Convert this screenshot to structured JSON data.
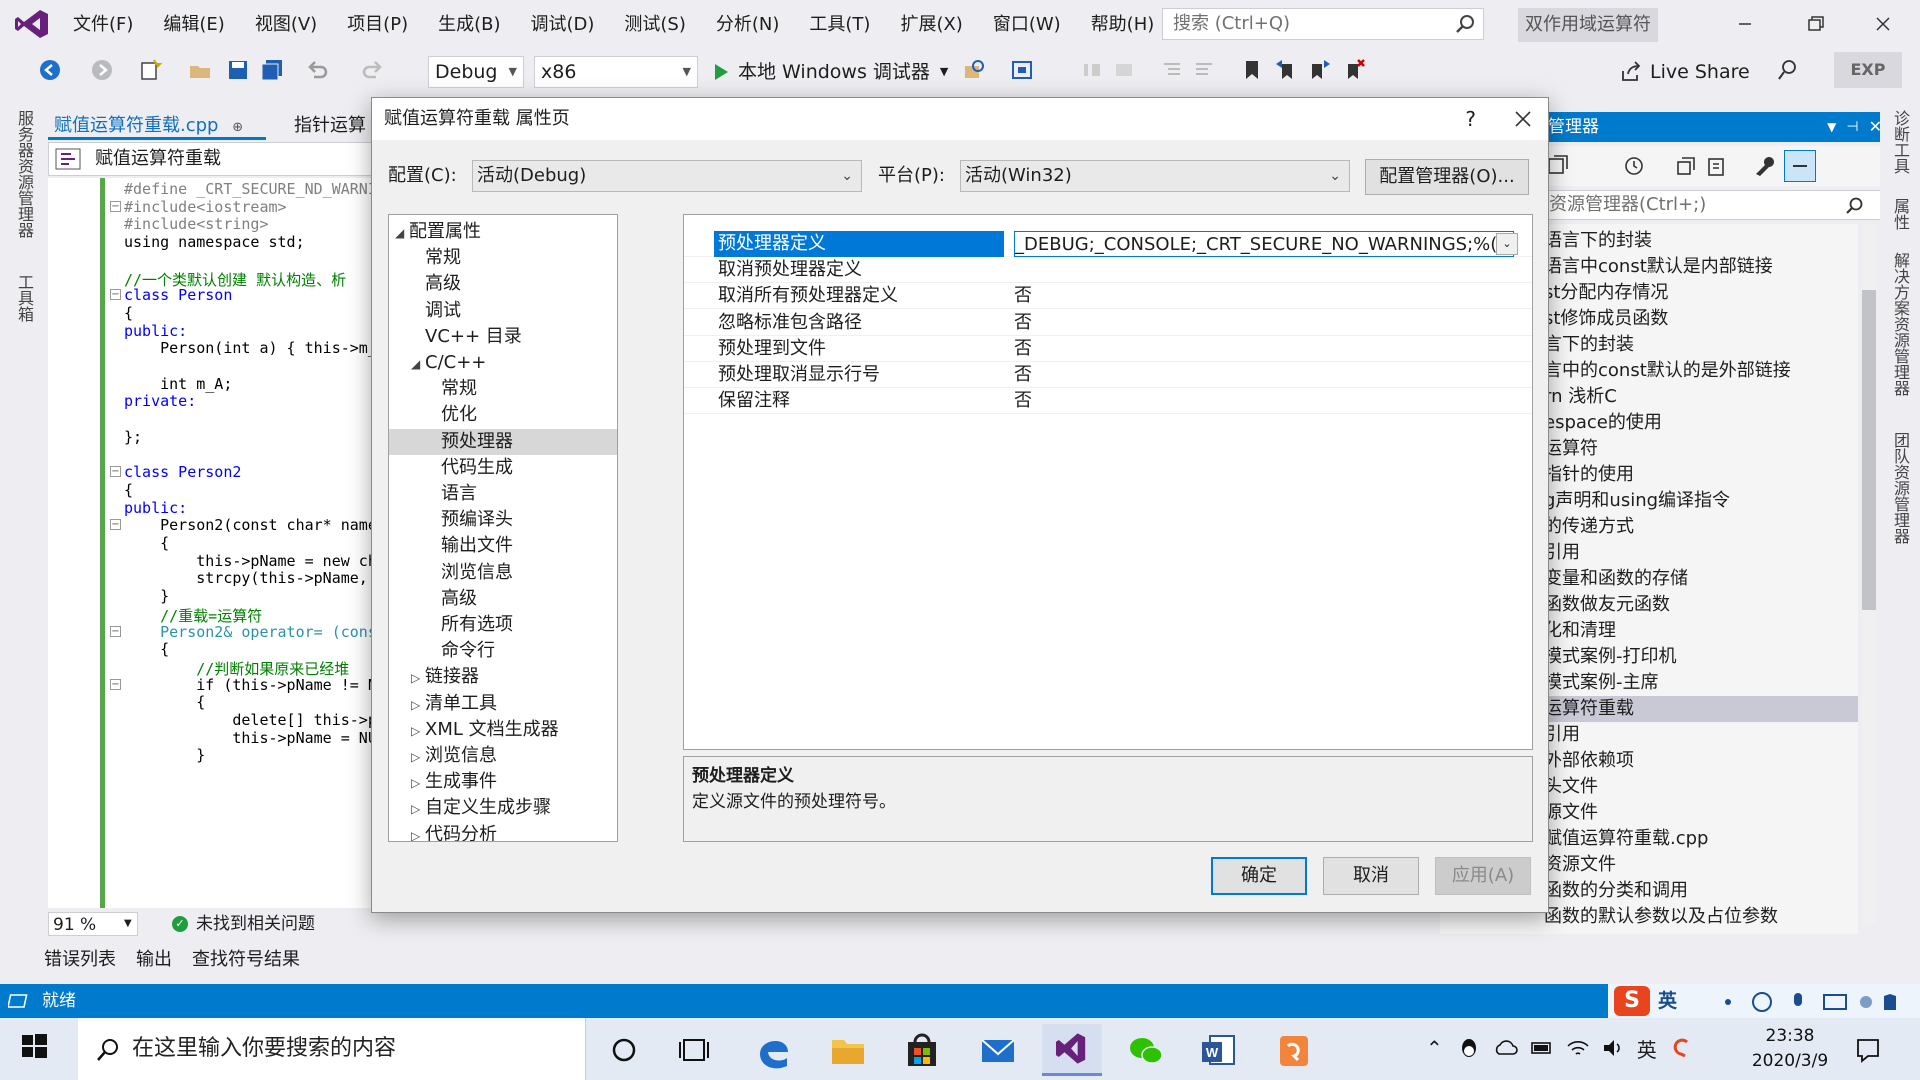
{
  "menu": [
    "文件(F)",
    "编辑(E)",
    "视图(V)",
    "项目(P)",
    "生成(B)",
    "调试(D)",
    "测试(S)",
    "分析(N)",
    "工具(T)",
    "扩展(X)",
    "窗口(W)",
    "帮助(H)"
  ],
  "search_placeholder": "搜索 (Ctrl+Q)",
  "project_title": "双作用域运算符",
  "toolbar": {
    "config": "Debug",
    "platform": "x86",
    "debug_start": "本地 Windows 调试器",
    "live_share": "Live Share",
    "exp": "EXP"
  },
  "left_rail": [
    "服务器资源管理器",
    "工具箱"
  ],
  "right_rail": [
    "诊断工具",
    "属性",
    "解决方案资源管理器",
    "团队资源管理器"
  ],
  "editor": {
    "tabs": [
      "赋值运算符重载.cpp",
      "指针运算符"
    ],
    "tab_pin": "⊕ ✕",
    "nav": "赋值运算符重载",
    "zoom": "91 %",
    "issues": "未找到相关问题"
  },
  "code_lines": [
    {
      "t": "#define _CRT_SECURE_ND_WARNI",
      "c": "pp"
    },
    {
      "t": "#include<iostream>",
      "c": "pp"
    },
    {
      "t": "#include<string>",
      "c": "pp"
    },
    {
      "t": "using namespace std;",
      "c": ""
    },
    {
      "t": "",
      "c": ""
    },
    {
      "t": "//一个类默认创建 默认构造、析",
      "c": "cm"
    },
    {
      "t": "class Person",
      "c": "kw"
    },
    {
      "t": "{",
      "c": ""
    },
    {
      "t": "public:",
      "c": "kw"
    },
    {
      "t": "    Person(int a) { this->m_",
      "c": ""
    },
    {
      "t": "",
      "c": ""
    },
    {
      "t": "    int m_A;",
      "c": ""
    },
    {
      "t": "private:",
      "c": "kw"
    },
    {
      "t": "",
      "c": ""
    },
    {
      "t": "};",
      "c": ""
    },
    {
      "t": "",
      "c": ""
    },
    {
      "t": "class Person2",
      "c": "kw"
    },
    {
      "t": "{",
      "c": ""
    },
    {
      "t": "public:",
      "c": "kw"
    },
    {
      "t": "    Person2(const char* name",
      "c": ""
    },
    {
      "t": "    {",
      "c": ""
    },
    {
      "t": "        this->pName = new ch",
      "c": ""
    },
    {
      "t": "        strcpy(this->pName,",
      "c": ""
    },
    {
      "t": "    }",
      "c": ""
    },
    {
      "t": "    //重载=运算符",
      "c": "cm"
    },
    {
      "t": "    Person2& operator= (cons",
      "c": "ty"
    },
    {
      "t": "    {",
      "c": ""
    },
    {
      "t": "        //判断如果原来已经堆",
      "c": "cm"
    },
    {
      "t": "        if (this->pName != N",
      "c": ""
    },
    {
      "t": "        {",
      "c": ""
    },
    {
      "t": "            delete[] this->p",
      "c": ""
    },
    {
      "t": "            this->pName = NU",
      "c": ""
    },
    {
      "t": "        }",
      "c": ""
    }
  ],
  "bottom_tabs": [
    "错误列表",
    "输出",
    "查找符号结果"
  ],
  "solution": {
    "header": "管理器",
    "search": "资源管理器(Ctrl+;)",
    "items": [
      "语言下的封装",
      "语言中const默认是内部链接",
      "st分配内存情况",
      "st修饰成员函数",
      "言下的封装",
      "言中的const默认的是外部链接",
      "rn 浅析C",
      "espace的使用",
      "运算符",
      "指针的使用",
      "g声明和using编译指令",
      "的传递方式",
      "引用",
      "变量和函数的存储",
      "函数做友元函数",
      "化和清理",
      "模式案例-打印机",
      "模式案例-主席",
      "运算符重载",
      "引用",
      "外部依赖项",
      "头文件",
      "源文件",
      "赋值运算符重载.cpp",
      "资源文件",
      "函数的分类和调用",
      "函数的默认参数以及占位参数"
    ],
    "selected_index": 18
  },
  "status": "就绪",
  "ime": {
    "lang": "英"
  },
  "taskbar": {
    "search": "在这里输入你要搜索的内容",
    "time": "23:38",
    "date": "2020/3/9",
    "tray_lang": "英"
  },
  "dialog": {
    "title": "赋值运算符重载 属性页",
    "help": "?",
    "config_label": "配置(C):",
    "config_value": "活动(Debug)",
    "platform_label": "平台(P):",
    "platform_value": "活动(Win32)",
    "config_manager": "配置管理器(O)...",
    "tree": [
      {
        "label": "配置属性",
        "level": 0,
        "arrow": "◢"
      },
      {
        "label": "常规",
        "level": 1,
        "arrow": ""
      },
      {
        "label": "高级",
        "level": 1,
        "arrow": ""
      },
      {
        "label": "调试",
        "level": 1,
        "arrow": ""
      },
      {
        "label": "VC++ 目录",
        "level": 1,
        "arrow": ""
      },
      {
        "label": "C/C++",
        "level": 1,
        "arrow": "◢"
      },
      {
        "label": "常规",
        "level": 2,
        "arrow": ""
      },
      {
        "label": "优化",
        "level": 2,
        "arrow": ""
      },
      {
        "label": "预处理器",
        "level": 2,
        "arrow": "",
        "selected": true
      },
      {
        "label": "代码生成",
        "level": 2,
        "arrow": ""
      },
      {
        "label": "语言",
        "level": 2,
        "arrow": ""
      },
      {
        "label": "预编译头",
        "level": 2,
        "arrow": ""
      },
      {
        "label": "输出文件",
        "level": 2,
        "arrow": ""
      },
      {
        "label": "浏览信息",
        "level": 2,
        "arrow": ""
      },
      {
        "label": "高级",
        "level": 2,
        "arrow": ""
      },
      {
        "label": "所有选项",
        "level": 2,
        "arrow": ""
      },
      {
        "label": "命令行",
        "level": 2,
        "arrow": ""
      },
      {
        "label": "链接器",
        "level": 1,
        "arrow": "▷"
      },
      {
        "label": "清单工具",
        "level": 1,
        "arrow": "▷"
      },
      {
        "label": "XML 文档生成器",
        "level": 1,
        "arrow": "▷"
      },
      {
        "label": "浏览信息",
        "level": 1,
        "arrow": "▷"
      },
      {
        "label": "生成事件",
        "level": 1,
        "arrow": "▷"
      },
      {
        "label": "自定义生成步骤",
        "level": 1,
        "arrow": "▷"
      },
      {
        "label": "代码分析",
        "level": 1,
        "arrow": "▷"
      }
    ],
    "properties": [
      {
        "name": "预处理器定义",
        "value": "_DEBUG;_CONSOLE;_CRT_SECURE_NO_WARNINGS;%(P",
        "selected": true
      },
      {
        "name": "取消预处理器定义",
        "value": ""
      },
      {
        "name": "取消所有预处理器定义",
        "value": "否"
      },
      {
        "name": "忽略标准包含路径",
        "value": "否"
      },
      {
        "name": "预处理到文件",
        "value": "否"
      },
      {
        "name": "预处理取消显示行号",
        "value": "否"
      },
      {
        "name": "保留注释",
        "value": "否"
      }
    ],
    "desc_title": "预处理器定义",
    "desc_text": "定义源文件的预处理符号。",
    "ok": "确定",
    "cancel": "取消",
    "apply": "应用(A)"
  }
}
